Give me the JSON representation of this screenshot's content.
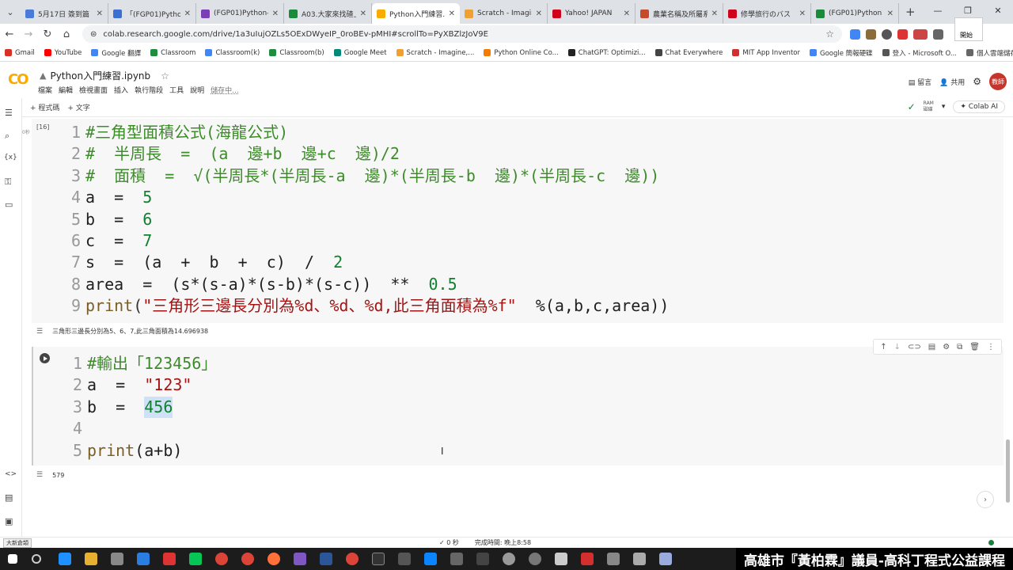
{
  "tabs": [
    {
      "label": "5月17日 簽到篇",
      "color": "#4a7bd8"
    },
    {
      "label": "「(FGP01)Python",
      "color": "#3b6fd1"
    },
    {
      "label": "(FGP01)Python-",
      "color": "#7b3fb5"
    },
    {
      "label": "A03.大家來找碴上",
      "color": "#1a8a3b"
    },
    {
      "label": "Python入門練習.",
      "color": "#f9ab00",
      "active": true
    },
    {
      "label": "Scratch - Imagin",
      "color": "#f0a030"
    },
    {
      "label": "Yahoo! JAPAN",
      "color": "#d0021b"
    },
    {
      "label": "農業名稱及所屬系",
      "color": "#c64b2b"
    },
    {
      "label": "修學旅行のバス",
      "color": "#d0021b"
    },
    {
      "label": "(FGP01)Python",
      "color": "#1a8a3b"
    }
  ],
  "address": {
    "url": "colab.research.google.com/drive/1a3uIujOZLs5OExDWyeIP_0roBEv-pMHI#scrollTo=PyXBZlzJoV9E"
  },
  "popup_label": "開始",
  "bookmarks": [
    "Gmail",
    "YouTube",
    "Google 翻譯",
    "Classroom",
    "Classroom(k)",
    "Classroom(b)",
    "Google Meet",
    "Scratch - Imagine,...",
    "Python Online Co...",
    "ChatGPT: Optimizi...",
    "Chat Everywhere",
    "MIT App Inventor",
    "Google 簡報硬碟",
    "登入 - Microsoft O...",
    "個人雲端儲存空間 -"
  ],
  "notebook": {
    "title": "Python入門練習.ipynb",
    "menu": [
      "檔案",
      "編輯",
      "檢視畫面",
      "插入",
      "執行階段",
      "工具",
      "說明"
    ],
    "saving": "儲存中...",
    "comment": "留言",
    "share": "共用",
    "avatar": "教師",
    "add_code": "+ 程式碼",
    "add_text": "+ 文字",
    "ram_label": "RAM",
    "disk_label": "磁碟",
    "colab_ai": "Colab AI"
  },
  "cell1": {
    "exec_count": "[16]",
    "exec_time": "0秒",
    "output": "三角形三邊長分別為5、6、7,此三角面積為14.696938"
  },
  "cell2": {
    "output": "579"
  },
  "code1": [
    {
      "n": "1",
      "parts": [
        {
          "t": "#三角型面積公式(海龍公式)",
          "c": "cmt"
        }
      ]
    },
    {
      "n": "2",
      "parts": [
        {
          "t": "#  半周長  =  (a  邊+b  邊+c  邊)/2",
          "c": "cmt"
        }
      ]
    },
    {
      "n": "3",
      "parts": [
        {
          "t": "#  面積  =  √(半周長*(半周長-a  邊)*(半周長-b  邊)*(半周長-c  邊))",
          "c": "cmt"
        }
      ]
    },
    {
      "n": "4",
      "parts": [
        {
          "t": "a  =  ",
          "c": "id"
        },
        {
          "t": "5",
          "c": "num"
        }
      ]
    },
    {
      "n": "5",
      "parts": [
        {
          "t": "b  =  ",
          "c": "id"
        },
        {
          "t": "6",
          "c": "num"
        }
      ]
    },
    {
      "n": "6",
      "parts": [
        {
          "t": "c  =  ",
          "c": "id"
        },
        {
          "t": "7",
          "c": "num"
        }
      ]
    },
    {
      "n": "7",
      "parts": [
        {
          "t": "s  =  (a  +  b  +  c)  /  ",
          "c": "id"
        },
        {
          "t": "2",
          "c": "num"
        }
      ]
    },
    {
      "n": "8",
      "parts": [
        {
          "t": "area  =  (s*(s-a)*(s-b)*(s-c))  **  ",
          "c": "id"
        },
        {
          "t": "0.5",
          "c": "num"
        }
      ]
    },
    {
      "n": "9",
      "parts": [
        {
          "t": "print",
          "c": "fn"
        },
        {
          "t": "(",
          "c": "op"
        },
        {
          "t": "\"三角形三邊長分別為%d、%d、%d,此三角面積為%f\"",
          "c": "str"
        },
        {
          "t": "  %(a,b,c,area))",
          "c": "id"
        }
      ]
    }
  ],
  "code2": [
    {
      "n": "1",
      "parts": [
        {
          "t": "#輸出「123456」",
          "c": "cmt"
        }
      ]
    },
    {
      "n": "2",
      "parts": [
        {
          "t": "a  =  ",
          "c": "id"
        },
        {
          "t": "\"123\"",
          "c": "str"
        }
      ]
    },
    {
      "n": "3",
      "parts": [
        {
          "t": "b  =  ",
          "c": "id"
        },
        {
          "t": "456",
          "c": "num sel"
        }
      ]
    },
    {
      "n": "4",
      "parts": [
        {
          "t": "",
          "c": "id"
        }
      ]
    },
    {
      "n": "5",
      "parts": [
        {
          "t": "print",
          "c": "fn"
        },
        {
          "t": "(a+b)",
          "c": "id"
        }
      ]
    }
  ],
  "status": {
    "time": "0 秒",
    "done": "完成時間: 晚上8:58",
    "ime": "大新倉頡"
  },
  "banner": "高雄市『黃柏霖』議員-高科丁程式公益課程"
}
